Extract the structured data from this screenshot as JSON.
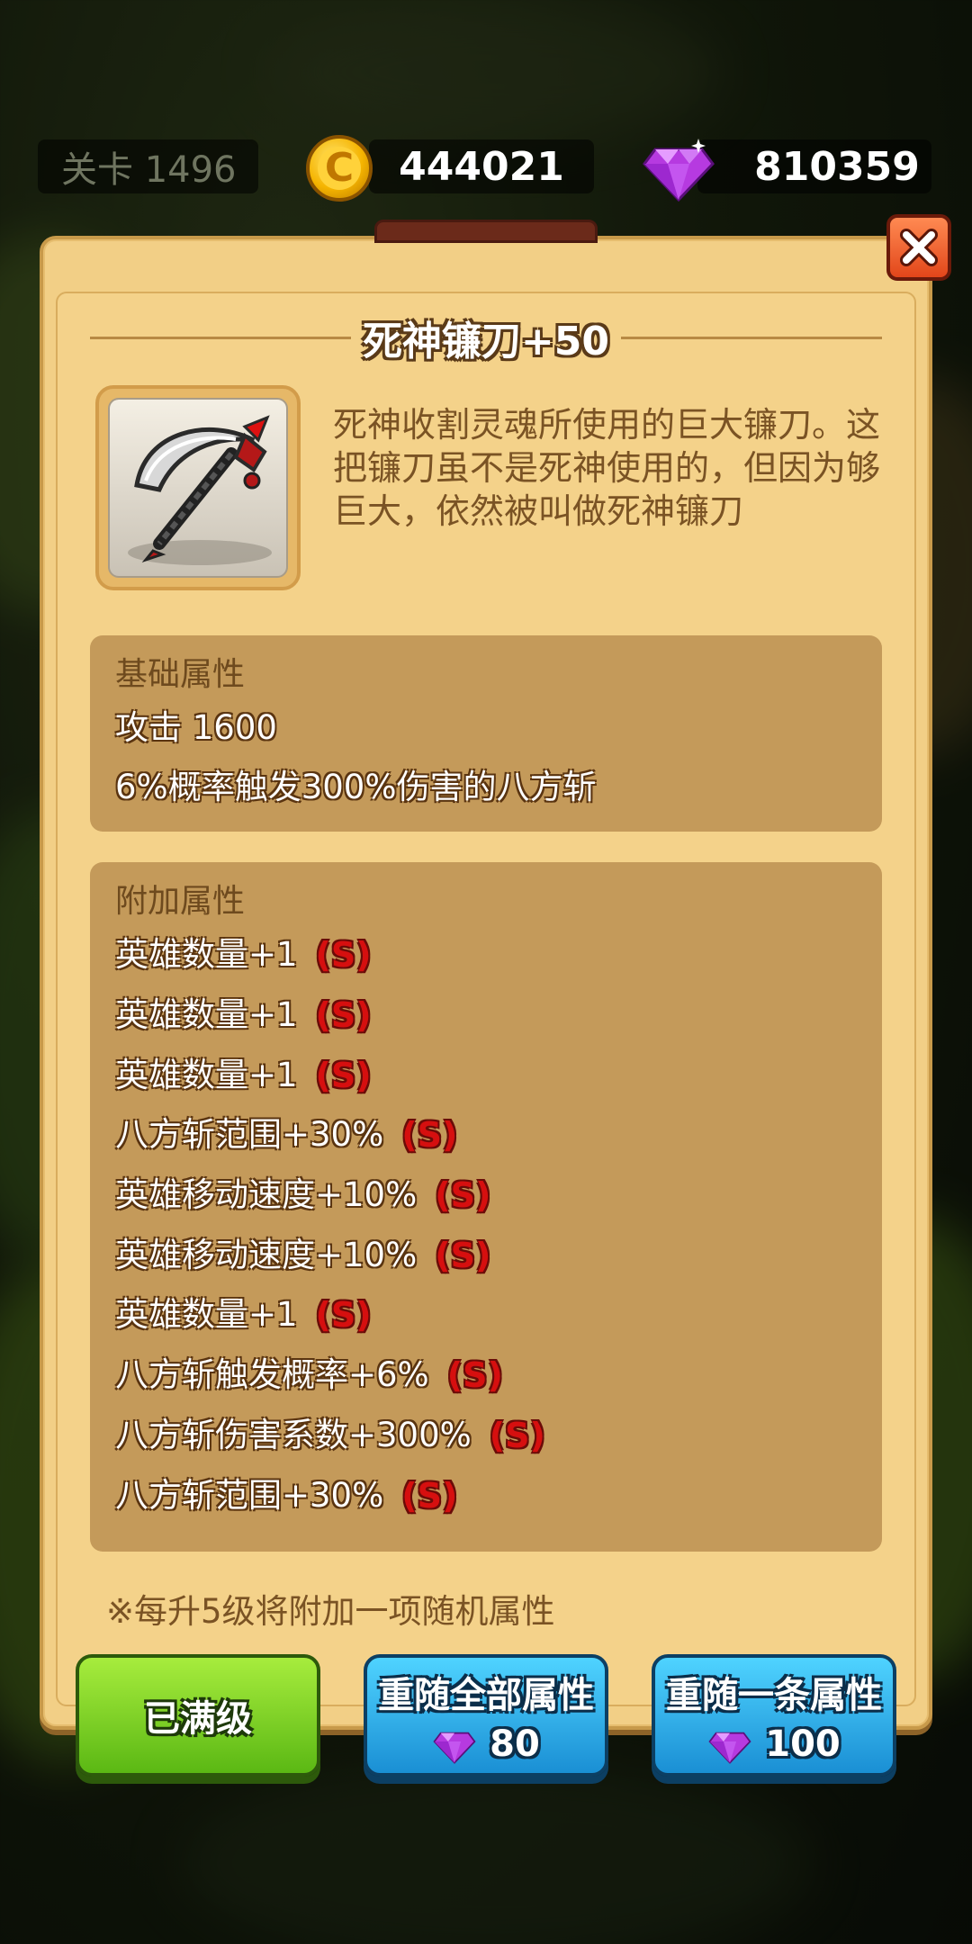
{
  "hud": {
    "level_text": "关卡 1496",
    "gold": "444021",
    "gems": "810359"
  },
  "dialog": {
    "title": "死神镰刀+50",
    "item_icon": "scythe-icon",
    "description": "死神收割灵魂所使用的巨大镰刀。这把镰刀虽不是死神使用的，但因为够巨大，依然被叫做死神镰刀",
    "base": {
      "heading": "基础属性",
      "stats": [
        "攻击 1600",
        "6%概率触发300%伤害的八方斩"
      ]
    },
    "extra": {
      "heading": "附加属性",
      "rank_label": "(S)",
      "stats": [
        "英雄数量+1",
        "英雄数量+1",
        "英雄数量+1",
        "八方斩范围+30%",
        "英雄移动速度+10%",
        "英雄移动速度+10%",
        "英雄数量+1",
        "八方斩触发概率+6%",
        "八方斩伤害系数+300%",
        "八方斩范围+30%"
      ]
    },
    "note": "※每升5级将附加一项随机属性"
  },
  "buttons": {
    "max_level": "已满级",
    "reroll_all": {
      "label": "重随全部属性",
      "cost": "80"
    },
    "reroll_one": {
      "label": "重随一条属性",
      "cost": "100"
    }
  },
  "colors": {
    "panel": "#f2cf86",
    "stat_box": "#c49a5a",
    "rank": "#d60f0f",
    "btn_green": "#5bb814",
    "btn_blue": "#1a8fd4"
  }
}
